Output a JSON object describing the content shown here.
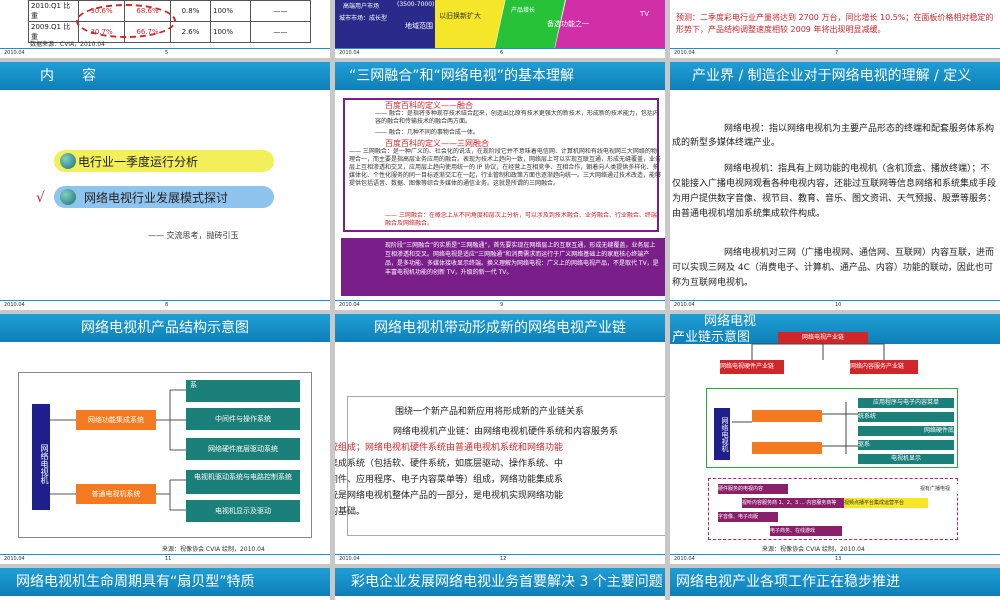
{
  "slide1": {
    "rows": [
      {
        "label": "2010.Q1 比重",
        "v1": "30.6%",
        "v2": "68.6%",
        "v3": "0.8%",
        "v4": "100%",
        "v5": "——"
      },
      {
        "label": "2009.Q1 比重",
        "v1": "30.7%",
        "v2": "66.7%",
        "v3": "2.6%",
        "v4": "100%",
        "v5": "——"
      }
    ],
    "source": "数据来源：CVIA，2010.04",
    "date": "2010.04",
    "page": "5"
  },
  "slide2": {
    "labels": [
      "高端用户市场",
      "(3500-7000)",
      "以旧换新扩大",
      "地域范围",
      "城市市场：成长型",
      "产品增长",
      "备选功能之一",
      "TV"
    ],
    "date": "2010.04",
    "page": "6"
  },
  "slide3": {
    "text": "预测：二季度彩电行业产量将达到 2700 万台，同比增长 10.5%；在面板价格相对稳定的形势下，产品结构调整速度相较 2009 年将出现明显减缓。",
    "date": "2010.04",
    "page": "7"
  },
  "slide4": {
    "title": "内　　容",
    "items": [
      "电行业一季度运行分析",
      "网络电视行业发展模式探讨"
    ],
    "check": "√",
    "note": "—— 交流思考，抛砖引玉",
    "date": "2010.04",
    "page": "8"
  },
  "slide5": {
    "title": "“三网融合”和“网络电视”的基本理解",
    "def1_title": "百度百科的定义——融合",
    "def1_body": "—— 融合：是指将多种现存技术结合起来，创造出比原有技术更强大的新技术，形成新的技术能力，包括内容的融合和传输技术的融合两方面。",
    "def1_line": "—— 融合：几种不同的事物合成一体。",
    "def2_title": "百度百科的定义——三网融合",
    "def2_body": "—— 三网融合：是一种广义的、社会化的说法，在现阶段它并不意味着电信网、计算机网和有线电视网三大网络的物理合一，而主要是指高层业务应用的融合。表现为技术上趋向一致，网络层上可以实现互联互通，形成无缝覆盖，业务层上互相渗透和交叉，应用层上趋向使用统一的 IP 协议，在经营上互相竞争、互相合作，朝着向人类提供多样化、多媒体化、个性化服务的同一目标逐渐交汇在一起，行业管制和政策方面也逐渐趋向统一。三大网络通过技术改造，能够提供包括语音、数据、图像等综合多媒体的通信业务。这就是所谓的三网融合。",
    "def2_line": "—— 三网融合：在概念上从不同角度和层次上分析，可以涉及到技术融合、业务融合、行业融合、终端融合及网络融合。",
    "purple": "现阶段“三网融合”的实质是“三网融通”，首先要实现在网络层上的互联互通，形成无缝覆盖，业务层上互相渗透和交叉。网络电视是适应“三网融通”和消费需求而运行于广义网络基础上的家庭核心终端产品，是多功能、多媒体接收显示终端。换义理解为网络电视：广义上的网络电视产品，不是取代 TV，是丰富电视机功能的创新 TV，升级的新一代 TV。",
    "date": "2010.04",
    "page": "9"
  },
  "slide6": {
    "title": "产业界 / 制造企业对于网络电视的理解 / 定义",
    "p1": "网络电视：指以网络电视机为主要产品形态的终端和配套服务体系构成的新型多媒体终端产业。",
    "p2": "网络电视机：指具有上网功能的电视机（含机顶盒、播放终端）；不仅能接入广播电视网观看各种电视内容，还能过互联网等信息网络和系统集成手段为用户提供数字音像、视节目、教育、音乐、图文资讯、天气预报、股票等服务：由普通电视机增加系统集成软件构成。",
    "p3": "网络电视机对三网（广播电视网、通信网、互联网）内容互联，进而可以实现三网及 4C（消费电子、计算机、通产品、内容）功能的联动，因此也可称为互联网电视机。",
    "date": "2010.04",
    "page": "10"
  },
  "slide7": {
    "title": "网络电视机产品结构示意图",
    "root": "网络电视机",
    "mid1": "网络功能集成系统",
    "mid2": "普通电视机系统",
    "leaves": [
      "系",
      "中间件与操作系统",
      "网络硬件底层驱动系统",
      "电视机驱动系统与电路控制系统",
      "电视机显示及驱动"
    ],
    "source": "来源：视像协会 CVIA 绘制，2010.04",
    "date": "2010.04",
    "page": "11"
  },
  "slide8": {
    "title": "网络电视机带动形成新的网络电视产业链",
    "lead": "围绕一个新产品和新应用将形成新的产业链关系",
    "l1": "网络电视机产业链：由网络电视机硬件系统和内容服务系",
    "l2": "统组成；网络电视机硬件系统由普通电视机系统和网络功能",
    "l3": "集成系统（包括软、硬件系统，如底层驱动、操作系统、中",
    "l4": "间件、应用程序、电子内容菜单等）组成，网络功能集成系",
    "l5": "统是网络电视机整体产品的一部分，是电视机实现网络功能",
    "l6": "的基础。",
    "date": "2010.04",
    "page": "12"
  },
  "slide9": {
    "title_line1": "网络电视",
    "title_line2": "产业链示意图",
    "top_box": "网络电视产业链",
    "left_head": "网络电视硬件产业链",
    "right_head": "网络内容服务产业链",
    "root": "网络电视机",
    "right_items": [
      "应用程序与电子内容菜单",
      "统系统",
      "网络硬件底",
      "驱系",
      "电视机显示"
    ],
    "bottom_items": [
      "硬件服务的电视内容",
      "视听内容服务商 1、2、3 … 内容服务商等",
      "视频点播平台集成运营平台",
      "字音像、电子出版",
      "电子商务、在线游戏"
    ],
    "bottom_right": "视有广播电视",
    "source": "来源：视像协会 CVIA 绘制，2010.04",
    "date": "2010.04",
    "page": "13"
  },
  "bottom_row": {
    "t1": "网络电视机生命周期具有“扇贝型”特质",
    "t2": "彩电企业发展网络电视业务首要解决 3 个主要问题",
    "t3": "网络电视产业各项工作正在稳步推进"
  },
  "colors": {
    "banner": "#1f9fd6",
    "teal": "#1b7f7a",
    "orange": "#f47a20",
    "navy": "#1f1f8c",
    "purple": "#7a1f8a",
    "red": "#d0262a"
  }
}
